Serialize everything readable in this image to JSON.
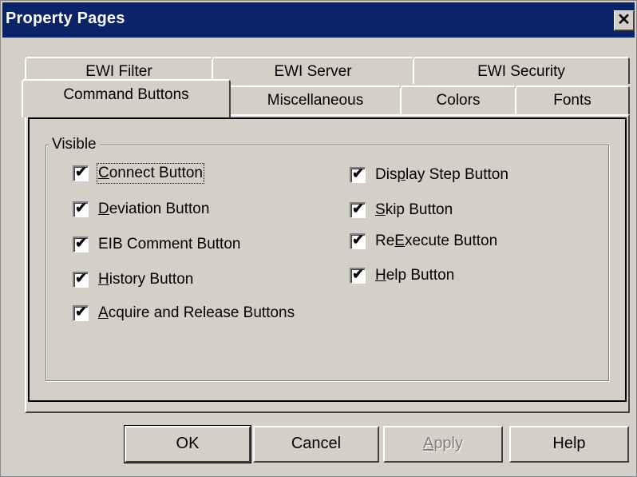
{
  "window": {
    "title": "Property Pages",
    "close_glyph": "✕"
  },
  "tabs_back": [
    {
      "label": "EWI Filter"
    },
    {
      "label": "EWI Server"
    },
    {
      "label": "EWI Security"
    }
  ],
  "tabs_front": [
    {
      "label": "Command Buttons",
      "active": true
    },
    {
      "label": "Miscellaneous"
    },
    {
      "label": "Colors"
    },
    {
      "label": "Fonts"
    }
  ],
  "group": {
    "label": "Visible"
  },
  "checkboxes": {
    "connect": {
      "pre": "",
      "key": "C",
      "post": "onnect Button",
      "checked": true
    },
    "deviation": {
      "pre": "",
      "key": "D",
      "post": "eviation Button",
      "checked": true
    },
    "eib": {
      "pre": "EIB Comment Button",
      "key": "",
      "post": "",
      "checked": true
    },
    "history": {
      "pre": "",
      "key": "H",
      "post": "istory Button",
      "checked": true
    },
    "acquire": {
      "pre": "",
      "key": "A",
      "post": "cquire and Release Buttons",
      "checked": true
    },
    "display": {
      "pre": "Dis",
      "key": "p",
      "post": "lay Step Button",
      "checked": true
    },
    "skip": {
      "pre": "",
      "key": "S",
      "post": "kip Button",
      "checked": true
    },
    "reexecute": {
      "pre": "Re",
      "key": "E",
      "post": "xecute Button",
      "checked": true
    },
    "help": {
      "pre": "",
      "key": "H",
      "post": "elp Button",
      "checked": true
    }
  },
  "check_glyph": "✔",
  "buttons": {
    "ok": "OK",
    "cancel": "Cancel",
    "apply": {
      "key": "A",
      "post": "pply",
      "disabled": true
    },
    "help": "Help"
  }
}
